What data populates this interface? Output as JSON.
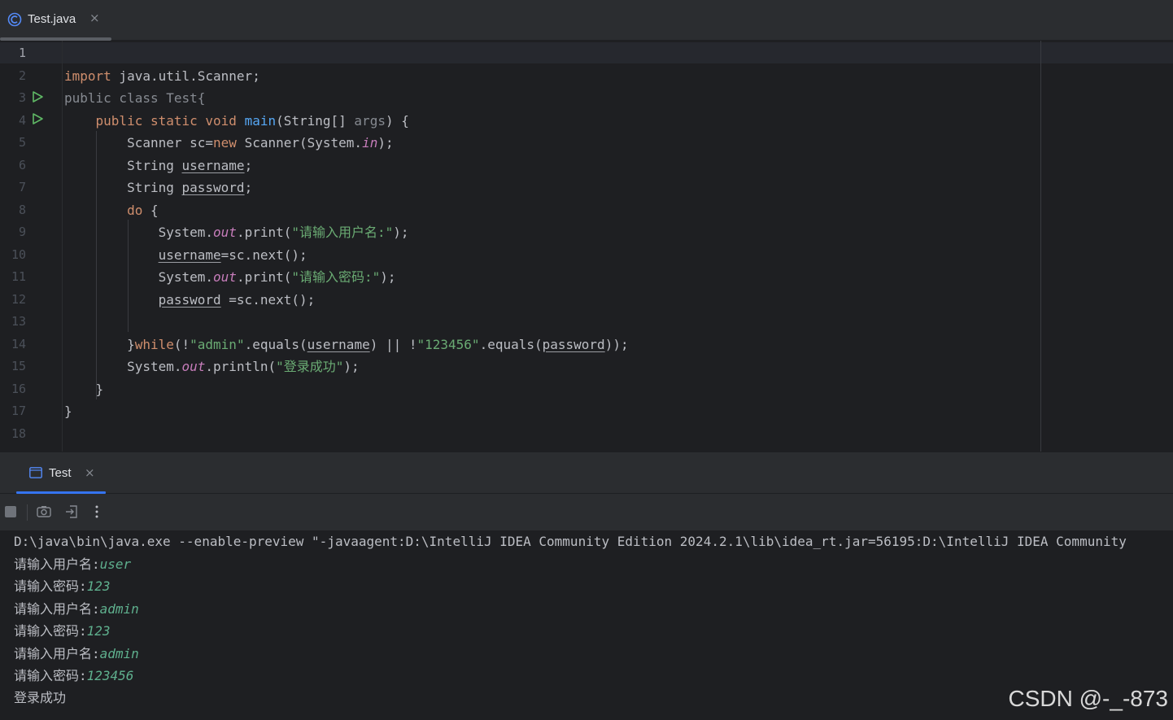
{
  "editor_tab": {
    "filename": "Test.java",
    "close_glyph": "×",
    "icon": "java-class-icon"
  },
  "gutter": {
    "line_numbers": [
      "1",
      "2",
      "3",
      "4",
      "5",
      "6",
      "7",
      "8",
      "9",
      "10",
      "11",
      "12",
      "13",
      "14",
      "15",
      "16",
      "17",
      "18"
    ],
    "run_icon": "run-gutter-icon"
  },
  "code": {
    "lines": [
      [],
      [
        {
          "t": "import",
          "c": "kw"
        },
        {
          "t": " java.util.Scanner;",
          "c": ""
        }
      ],
      [
        {
          "t": "public class Test{",
          "c": "dim"
        }
      ],
      [
        {
          "t": "    ",
          "c": ""
        },
        {
          "t": "public static void ",
          "c": "kw"
        },
        {
          "t": "main",
          "c": "fn"
        },
        {
          "t": "(String[] ",
          "c": ""
        },
        {
          "t": "args",
          "c": "dim"
        },
        {
          "t": ") {",
          "c": ""
        }
      ],
      [
        {
          "t": "        Scanner sc=",
          "c": ""
        },
        {
          "t": "new",
          "c": "kw"
        },
        {
          "t": " Scanner(System.",
          "c": ""
        },
        {
          "t": "in",
          "c": "fld"
        },
        {
          "t": ");",
          "c": ""
        }
      ],
      [
        {
          "t": "        String ",
          "c": ""
        },
        {
          "t": "username",
          "c": "uvar"
        },
        {
          "t": ";",
          "c": ""
        }
      ],
      [
        {
          "t": "        String ",
          "c": ""
        },
        {
          "t": "password",
          "c": "uvar"
        },
        {
          "t": ";",
          "c": ""
        }
      ],
      [
        {
          "t": "        ",
          "c": ""
        },
        {
          "t": "do",
          "c": "kw"
        },
        {
          "t": " {",
          "c": ""
        }
      ],
      [
        {
          "t": "            System.",
          "c": ""
        },
        {
          "t": "out",
          "c": "fld"
        },
        {
          "t": ".print(",
          "c": ""
        },
        {
          "t": "\"请输入用户名:\"",
          "c": "str"
        },
        {
          "t": ");",
          "c": ""
        }
      ],
      [
        {
          "t": "            ",
          "c": ""
        },
        {
          "t": "username",
          "c": "uvar"
        },
        {
          "t": "=sc.next();",
          "c": ""
        }
      ],
      [
        {
          "t": "            System.",
          "c": ""
        },
        {
          "t": "out",
          "c": "fld"
        },
        {
          "t": ".print(",
          "c": ""
        },
        {
          "t": "\"请输入密码:\"",
          "c": "str"
        },
        {
          "t": ");",
          "c": ""
        }
      ],
      [
        {
          "t": "            ",
          "c": ""
        },
        {
          "t": "password",
          "c": "uvar"
        },
        {
          "t": " =sc.next();",
          "c": ""
        }
      ],
      [],
      [
        {
          "t": "        }",
          "c": ""
        },
        {
          "t": "while",
          "c": "kw"
        },
        {
          "t": "(!",
          "c": ""
        },
        {
          "t": "\"admin\"",
          "c": "str"
        },
        {
          "t": ".equals(",
          "c": ""
        },
        {
          "t": "username",
          "c": "uvar"
        },
        {
          "t": ") || !",
          "c": ""
        },
        {
          "t": "\"123456\"",
          "c": "str"
        },
        {
          "t": ".equals(",
          "c": ""
        },
        {
          "t": "password",
          "c": "uvar"
        },
        {
          "t": "));",
          "c": ""
        }
      ],
      [
        {
          "t": "        System.",
          "c": ""
        },
        {
          "t": "out",
          "c": "fld"
        },
        {
          "t": ".println(",
          "c": ""
        },
        {
          "t": "\"登录成功\"",
          "c": "str"
        },
        {
          "t": ");",
          "c": ""
        }
      ],
      [
        {
          "t": "    }",
          "c": ""
        }
      ],
      [
        {
          "t": "}",
          "c": ""
        }
      ],
      []
    ]
  },
  "run_panel": {
    "tab_label": "Test",
    "close_glyph": "×",
    "toolbar_icons": [
      "stop-icon",
      "camera-icon",
      "exit-icon",
      "more-vertical-icon"
    ]
  },
  "console": {
    "command": "D:\\java\\bin\\java.exe --enable-preview \"-javaagent:D:\\IntelliJ IDEA Community Edition 2024.2.1\\lib\\idea_rt.jar=56195:D:\\IntelliJ IDEA Community",
    "lines": [
      {
        "prompt": "请输入用户名:",
        "input": "user"
      },
      {
        "prompt": "请输入密码:",
        "input": "123"
      },
      {
        "prompt": "请输入用户名:",
        "input": "admin"
      },
      {
        "prompt": "请输入密码:",
        "input": "123"
      },
      {
        "prompt": "请输入用户名:",
        "input": "admin"
      },
      {
        "prompt": "请输入密码:",
        "input": "123456"
      }
    ],
    "result": "登录成功"
  },
  "watermark": "CSDN @-_-873",
  "colors": {
    "background": "#1e1f22",
    "keyword": "#cf8e6d",
    "string": "#6aab73",
    "method": "#56a8f5",
    "field": "#c77dbb",
    "input": "#5fb08e",
    "run_green": "#5fb865",
    "accent": "#3574f0"
  }
}
